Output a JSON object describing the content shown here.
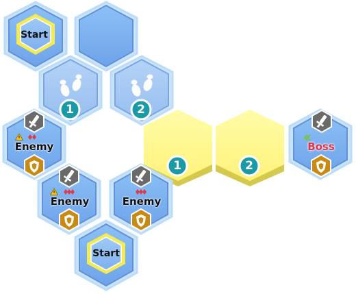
{
  "tiles": {
    "start_top_label": "Start",
    "start_bottom_label": "Start",
    "step_1_number": "1",
    "step_2_number": "2",
    "yellow_1_number": "1",
    "yellow_2_number": "2",
    "enemy_left_label": "Enemy",
    "enemy_mid_label": "Enemy",
    "enemy_right_label": "Enemy",
    "boss_label": "Boss"
  },
  "icons": {
    "sword": "sword-icon",
    "shield": "shield-icon",
    "footprints": "footprints-icon",
    "warning": "warning-icon",
    "danger_diamonds": "danger-diamond-icon",
    "chevrons": "chevron-left-icon"
  },
  "colors": {
    "blue_tile": "#7fb0ef",
    "blue_tile_border": "#b9dcfb",
    "yellow_tile": "#fff78a",
    "yellow_shadow": "#d4c94c",
    "start_ring": "#f4ea52",
    "badge_teal": "#1a9aa6",
    "shield_gold": "#c88a10",
    "sword_gray": "#6a6a6a"
  }
}
